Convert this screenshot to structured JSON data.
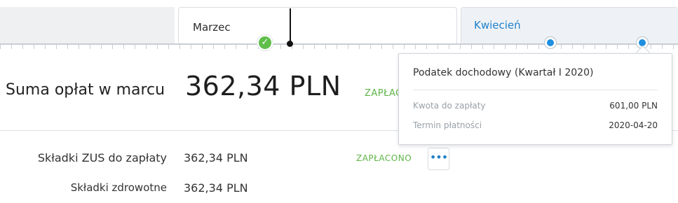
{
  "months": {
    "current_label": "Marzec",
    "next_label": "Kwiecień"
  },
  "timeline": {
    "paid_icon": "check-icon",
    "due_icon": "due-dot-icon"
  },
  "summary": {
    "label": "Suma opłat w marcu",
    "amount": "362,34 PLN",
    "status": "ZAPŁACO"
  },
  "rows": [
    {
      "label": "Składki ZUS do zapłaty",
      "amount": "362,34 PLN",
      "status": "ZAPŁACONO",
      "more_label": "•••"
    },
    {
      "label": "Składki zdrowotne",
      "amount": "362,34 PLN"
    }
  ],
  "tooltip": {
    "title": "Podatek dochodowy (Kwartał I 2020)",
    "items": [
      {
        "key": "Kwota do zapłaty",
        "value": "601,00 PLN"
      },
      {
        "key": "Termin płatności",
        "value": "2020-04-20"
      }
    ]
  },
  "colors": {
    "accent_blue": "#1f7fc8",
    "paid_green": "#5fb548",
    "cursor": "#111111"
  }
}
